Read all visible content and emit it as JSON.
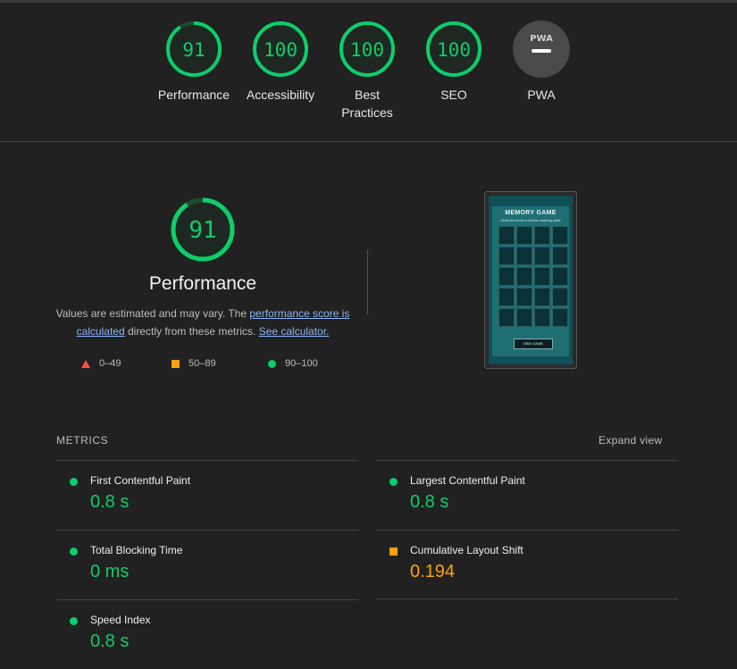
{
  "colors": {
    "background": "#212121",
    "pass": "#0cce6b",
    "average": "#ffa400",
    "fail": "#ff4e42",
    "link": "#8ab4f8",
    "pwa_gauge": "#4a4a4a"
  },
  "gauges": [
    {
      "score": "91",
      "label": "Performance",
      "fraction": 0.91,
      "status": "pass"
    },
    {
      "score": "100",
      "label": "Accessibility",
      "fraction": 1.0,
      "status": "pass"
    },
    {
      "score": "100",
      "label": "Best Practices",
      "fraction": 1.0,
      "status": "pass"
    },
    {
      "score": "100",
      "label": "SEO",
      "fraction": 1.0,
      "status": "pass"
    },
    {
      "label": "PWA",
      "icon": "pwa-icon",
      "badge_text": "PWA"
    }
  ],
  "performance": {
    "score": "91",
    "fraction": 0.91,
    "title": "Performance",
    "desc_pre": "Values are estimated and may vary. The ",
    "desc_link1": "performance score is calculated",
    "desc_mid": " directly from these metrics. ",
    "desc_link2": "See calculator."
  },
  "legend": [
    {
      "shape": "triangle",
      "range": "0–49"
    },
    {
      "shape": "square",
      "range": "50–89"
    },
    {
      "shape": "circle",
      "range": "90–100"
    }
  ],
  "thumbnail": {
    "title": "MEMORY GAME",
    "subtitle": "Select the boxes to find the matching pairs!",
    "button": "NEW GAME",
    "grid_cells": 20
  },
  "metrics": {
    "heading": "METRICS",
    "expand_label": "Expand view",
    "items": [
      {
        "name": "First Contentful Paint",
        "value": "0.8 s",
        "status": "pass"
      },
      {
        "name": "Largest Contentful Paint",
        "value": "0.8 s",
        "status": "pass"
      },
      {
        "name": "Total Blocking Time",
        "value": "0 ms",
        "status": "pass"
      },
      {
        "name": "Cumulative Layout Shift",
        "value": "0.194",
        "status": "average"
      },
      {
        "name": "Speed Index",
        "value": "0.8 s",
        "status": "pass"
      }
    ]
  }
}
